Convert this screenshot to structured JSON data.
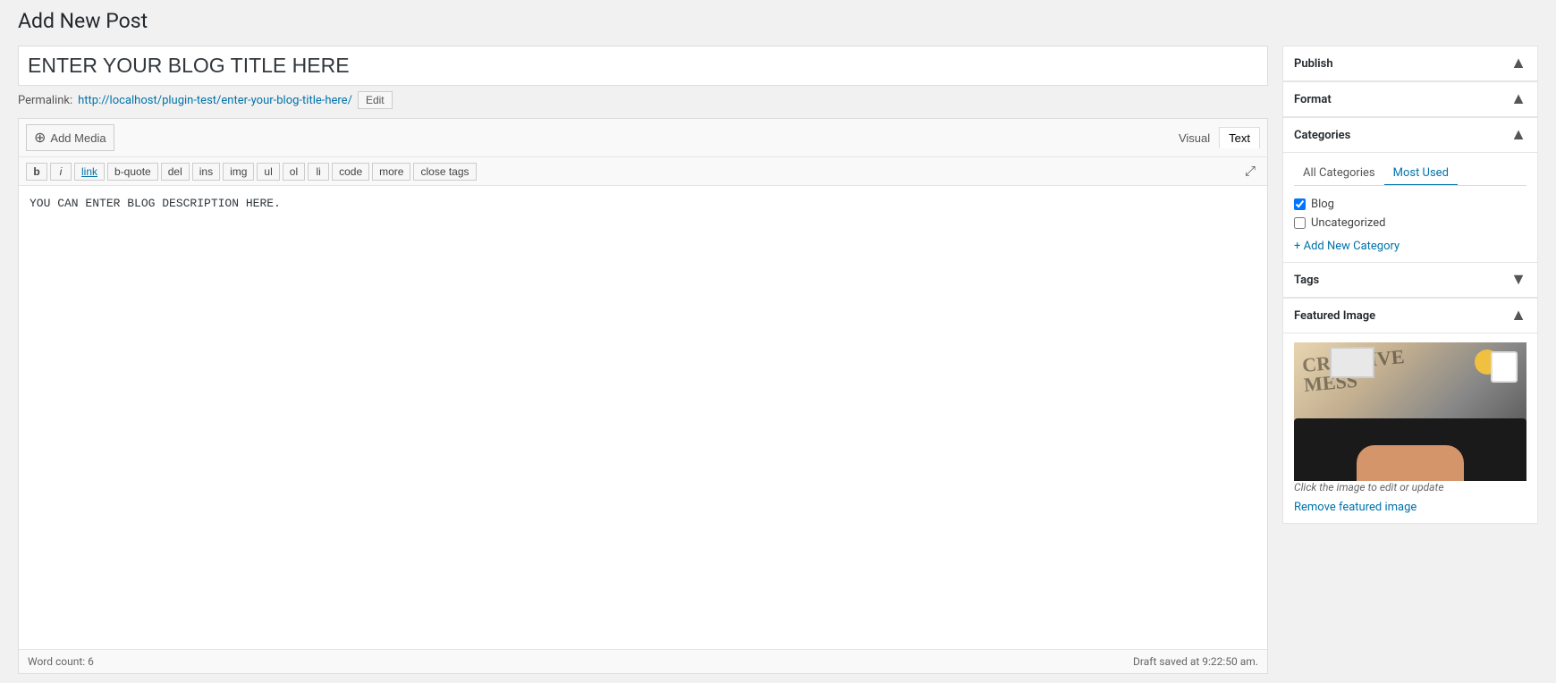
{
  "page": {
    "title": "Add New Post"
  },
  "post": {
    "title": "ENTER YOUR BLOG TITLE HERE",
    "content": "YOU CAN ENTER BLOG DESCRIPTION HERE.",
    "permalink_label": "Permalink:",
    "permalink_url": "http://localhost/plugin-test/enter-your-blog-title-here/",
    "permalink_edit_btn": "Edit",
    "word_count_label": "Word count: 6",
    "draft_saved": "Draft saved at 9:22:50 am."
  },
  "toolbar": {
    "add_media": "Add Media",
    "view_visual": "Visual",
    "view_text": "Text",
    "buttons": [
      "b",
      "i",
      "link",
      "b-quote",
      "del",
      "ins",
      "img",
      "ul",
      "ol",
      "li",
      "code",
      "more",
      "close tags"
    ]
  },
  "sidebar": {
    "publish": {
      "header": "Publish",
      "toggle": "▲"
    },
    "format": {
      "header": "Format",
      "toggle": "▲"
    },
    "categories": {
      "header": "Categories",
      "toggle": "▲",
      "tabs": [
        "All Categories",
        "Most Used"
      ],
      "items": [
        {
          "label": "Blog",
          "checked": true
        },
        {
          "label": "Uncategorized",
          "checked": false
        }
      ],
      "add_new_label": "+ Add New Category"
    },
    "tags": {
      "header": "Tags",
      "toggle": "▼"
    },
    "featured_image": {
      "header": "Featured Image",
      "toggle": "▲",
      "hint": "Click the image to edit or update",
      "remove_label": "Remove featured image"
    }
  }
}
